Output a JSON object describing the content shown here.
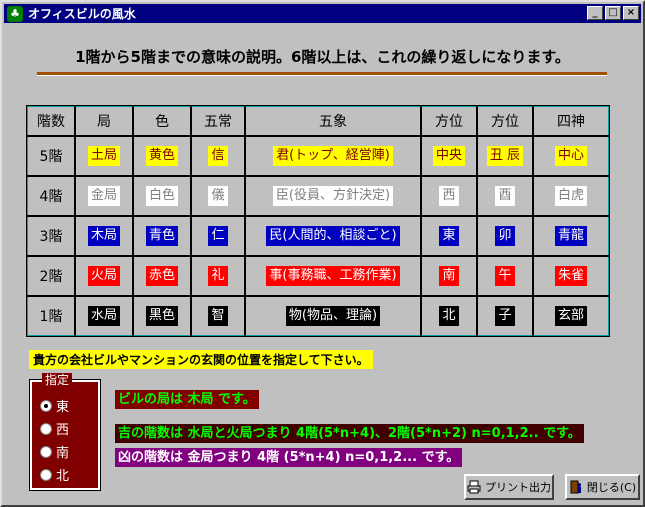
{
  "window": {
    "title": "オフィスビルの風水",
    "icon": "clover-icon",
    "buttons": {
      "minimize": "_",
      "maximize": "□",
      "close": "×"
    }
  },
  "heading": "1階から5階までの意味の説明。6階以上は、これの繰り返しになります。",
  "table": {
    "headers": [
      "階数",
      "局",
      "色",
      "五常",
      "五象",
      "方位",
      "方位",
      "四神"
    ],
    "rows": [
      {
        "floor": "5階",
        "cells": [
          "土局",
          "黄色",
          "信",
          "君(トップ、経営陣)",
          "中央",
          "丑 辰",
          "中心"
        ],
        "fg": "#800000",
        "bg": "#ffff00"
      },
      {
        "floor": "4階",
        "cells": [
          "金局",
          "白色",
          "儀",
          "臣(役員、方針決定)",
          "西",
          "酉",
          "白虎"
        ],
        "fg": "#808080",
        "bg": "#ffffff"
      },
      {
        "floor": "3階",
        "cells": [
          "木局",
          "青色",
          "仁",
          "民(人間的、相談ごと)",
          "東",
          "卯",
          "青龍"
        ],
        "fg": "#ffffff",
        "bg": "#0000c0"
      },
      {
        "floor": "2階",
        "cells": [
          "火局",
          "赤色",
          "礼",
          "事(事務職、工務作業)",
          "南",
          "午",
          "朱雀"
        ],
        "fg": "#ffffff",
        "bg": "#ff0000"
      },
      {
        "floor": "1階",
        "cells": [
          "水局",
          "黒色",
          "智",
          "物(物品、理論)",
          "北",
          "子",
          "玄部"
        ],
        "fg": "#ffffff",
        "bg": "#000000"
      }
    ]
  },
  "instruction": "貴方の会社ビルやマンションの玄関の位置を指定して下さい。",
  "selector": {
    "legend": "指定",
    "options": [
      "東",
      "西",
      "南",
      "北"
    ],
    "selected": "東"
  },
  "messages": {
    "bureau": "ビルの局は 木局 です。",
    "lucky": "吉の階数は 水局と火局つまり 4階(5*n+4)、2階(5*n+2) n=0,1,2.. です。",
    "unlucky": "凶の階数は 金局つまり 4階 (5*n+4) n=0,1,2... です。"
  },
  "buttons": {
    "print": "プリント出力",
    "close": "閉じる(C)"
  }
}
